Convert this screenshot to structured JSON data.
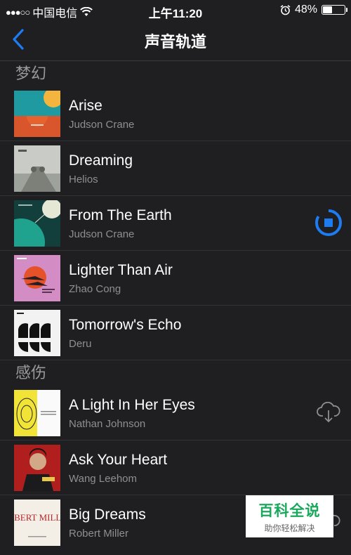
{
  "status_bar": {
    "carrier": "中国电信",
    "time": "上午11:20",
    "battery": "48%",
    "battery_level": 0.48
  },
  "nav": {
    "title": "声音轨道",
    "accent_color": "#1d7cf2"
  },
  "sections": [
    {
      "header": "梦幻",
      "tracks": [
        {
          "title": "Arise",
          "artist": "Judson Crane"
        },
        {
          "title": "Dreaming",
          "artist": "Helios"
        },
        {
          "title": "From The Earth",
          "artist": "Judson Crane",
          "action": "download-progress-icon"
        },
        {
          "title": "Lighter Than Air",
          "artist": "Zhao Cong"
        },
        {
          "title": "Tomorrow's Echo",
          "artist": "Deru"
        }
      ]
    },
    {
      "header": "感伤",
      "tracks": [
        {
          "title": "A Light In Her Eyes",
          "artist": "Nathan Johnson",
          "action": "cloud-download-icon"
        },
        {
          "title": "Ask Your Heart",
          "artist": "Wang Leehom"
        },
        {
          "title": "Big Dreams",
          "artist": "Robert Miller",
          "action": "cloud-download-icon",
          "cover_text": "ROBERT MILLER"
        }
      ]
    }
  ],
  "watermark": {
    "main": "百科全说",
    "sub": "助你轻松解决"
  }
}
